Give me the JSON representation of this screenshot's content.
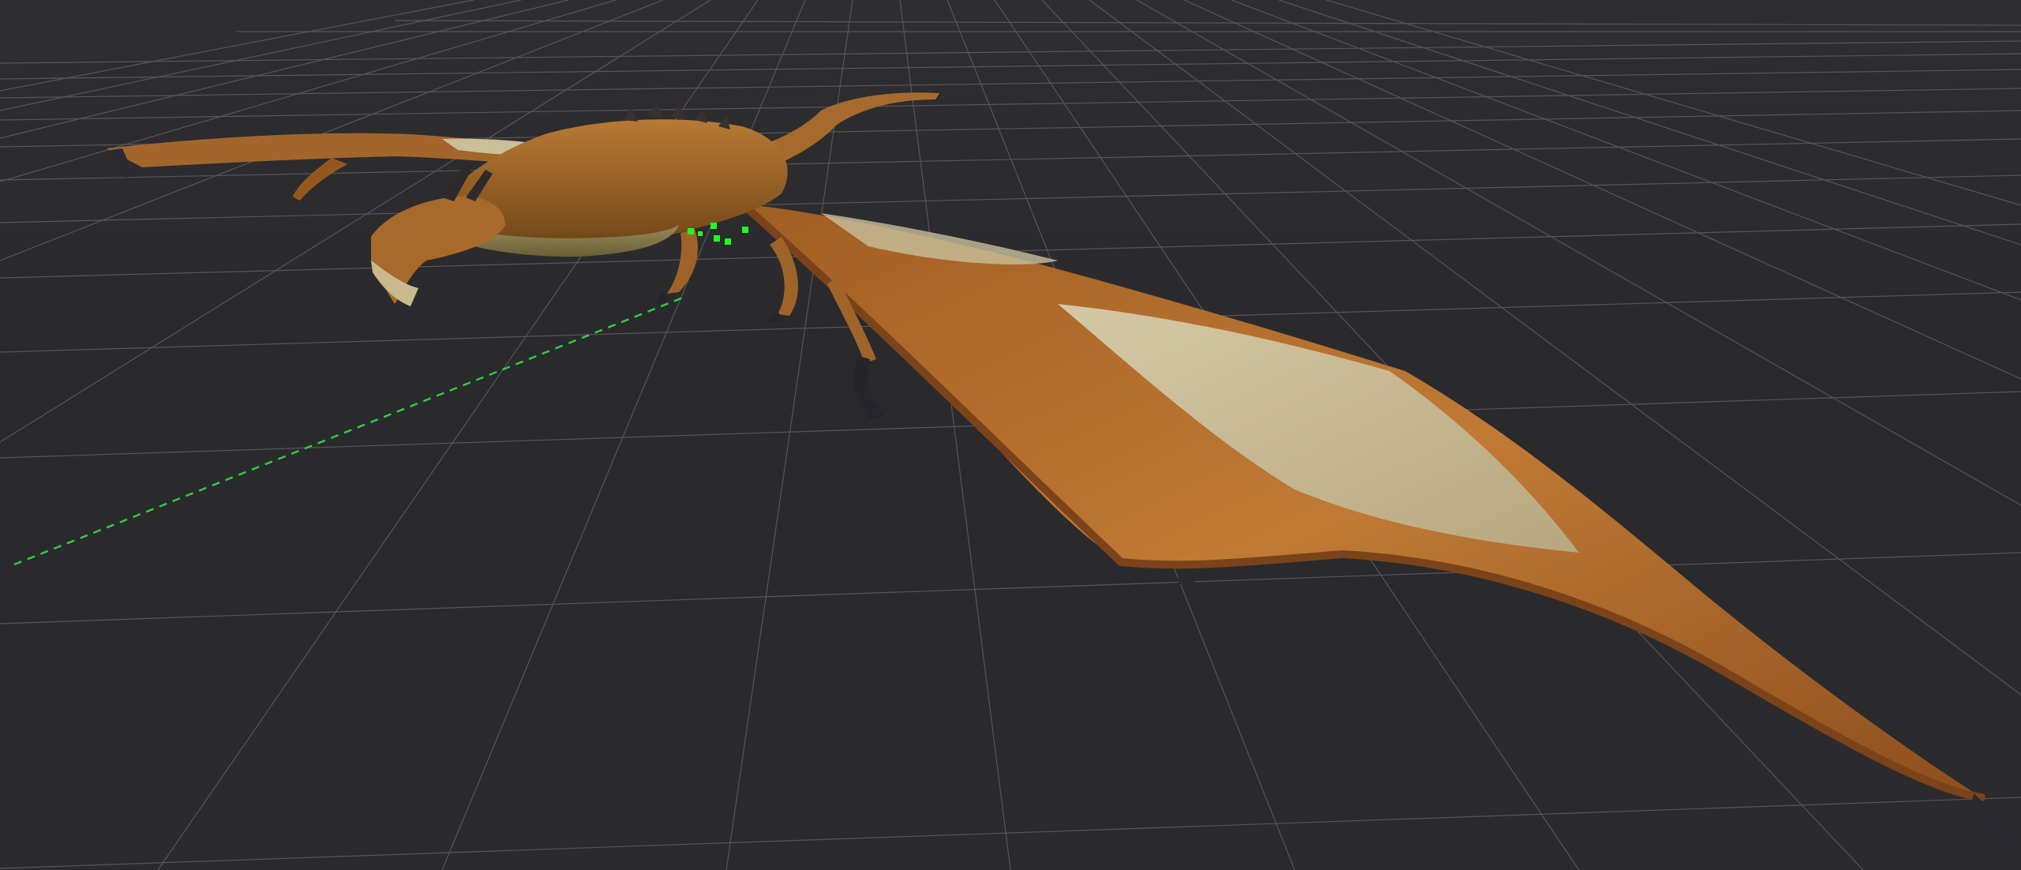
{
  "viewport": {
    "background": "#2b2b2d",
    "grid": {
      "visible": true,
      "line_color": "#6a6a6c",
      "major_line_color": "#8a8a8c"
    },
    "motion_path": {
      "visible": true,
      "style": "dashed",
      "color": "#2ecc40"
    },
    "selected_joints": {
      "color": "#1fff1f",
      "count": 6
    },
    "model": {
      "name_icon": "dragon-model-icon",
      "skin_color": "#b06a2a",
      "membrane_color": "#cfc4a0",
      "claw_color": "#2a2a30"
    }
  }
}
